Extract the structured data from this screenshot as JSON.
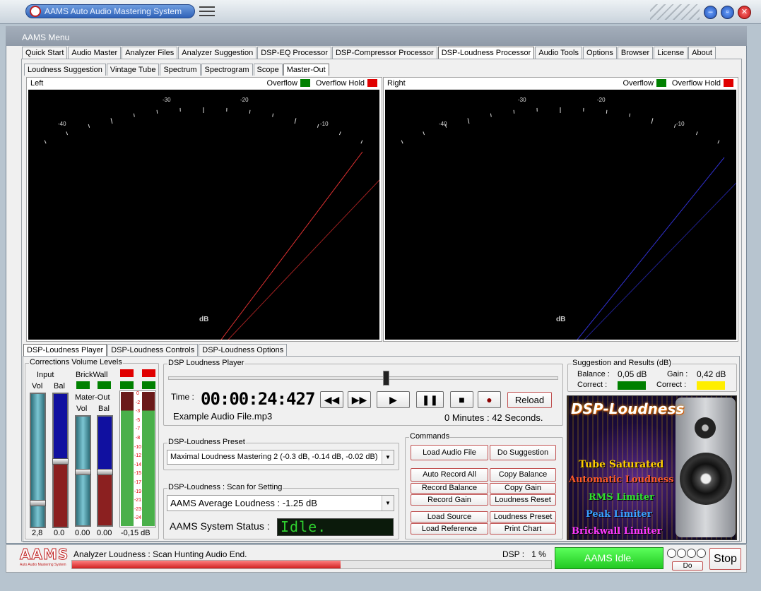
{
  "window": {
    "title": "AAMS Auto Audio Mastering System"
  },
  "menu_label": "AAMS Menu",
  "main_tabs": [
    "Quick Start",
    "Audio Master",
    "Analyzer Files",
    "Analyzer Suggestion",
    "DSP-EQ Processor",
    "DSP-Compressor Processor",
    "DSP-Loudness Processor",
    "Audio Tools",
    "Options",
    "Browser",
    "License",
    "About"
  ],
  "sub_tabs": [
    "Loudness Suggestion",
    "Vintage Tube",
    "Spectrum",
    "Spectrogram",
    "Scope",
    "Master-Out"
  ],
  "meters": {
    "left": {
      "label": "Left",
      "overflow": "Overflow",
      "overflow_hold": "Overflow Hold",
      "unit": "dB",
      "ticks": [
        "-40",
        "-30",
        "-20",
        "-10"
      ]
    },
    "right": {
      "label": "Right",
      "overflow": "Overflow",
      "overflow_hold": "Overflow Hold",
      "unit": "dB",
      "ticks": [
        "-40",
        "-30",
        "-20",
        "-10"
      ]
    }
  },
  "lower_tabs": [
    "DSP-Loudness Player",
    "DSP-Loudness Controls",
    "DSP-Loudness Options"
  ],
  "corrections": {
    "title": "Corrections Volume Levels",
    "input": "Input",
    "brickwall": "BrickWall",
    "mater_out": "Mater-Out",
    "vol": "Vol",
    "bal": "Bal",
    "vol_value": "2,8",
    "bal_value": "0.0",
    "out_vol_value": "0.00",
    "out_bal_value": "0.00",
    "meter_value": "-0,15 dB",
    "scale": [
      "0",
      "-2",
      "-3",
      "-5",
      "-7",
      "-8",
      "-10",
      "-12",
      "-14",
      "-15",
      "-17",
      "-19",
      "-21",
      "-23",
      "-24"
    ]
  },
  "player": {
    "title": "DSP Loudness Player",
    "time_label": "Time :",
    "time": "00:00:24:427",
    "file": "Example Audio File.mp3",
    "duration": "0 Minutes : 42 Seconds.",
    "reload": "Reload",
    "position_fraction": 0.56
  },
  "preset": {
    "title": "DSP-Loudness Preset",
    "value": "Maximal Loudness Mastering  2  (-0.3 dB, -0.14 dB, -0.02 dB)"
  },
  "scan": {
    "title": "DSP-Loudness : Scan for Setting",
    "value": "AAMS Average Loudness : -1.25 dB",
    "status_label": "AAMS System Status :",
    "status": "Idle."
  },
  "commands": {
    "title": "Commands",
    "load_audio": "Load Audio File",
    "do_suggestion": "Do Suggestion",
    "auto_record": "Auto Record All",
    "copy_balance": "Copy Balance",
    "record_balance": "Record Balance",
    "copy_gain": "Copy Gain",
    "record_gain": "Record Gain",
    "loudness_reset": "Loudness Reset",
    "load_source": "Load Source",
    "loudness_preset": "Loudness Preset",
    "load_reference": "Load Reference",
    "print_chart": "Print Chart"
  },
  "suggestion": {
    "title": "Suggestion and Results (dB)",
    "balance_label": "Balance :",
    "balance": "0,05 dB",
    "gain_label": "Gain :",
    "gain": "0,42 dB",
    "correct1": "Correct :",
    "correct2": "Correct :",
    "color_balance": "#008000",
    "color_gain": "#ffee00"
  },
  "banner": {
    "title": "DSP-Loudness",
    "lines": [
      "Tube Saturated",
      "Automatic Loudness",
      "RMS Limiter",
      "Peak Limiter",
      "Brickwall Limiter"
    ]
  },
  "statusbar": {
    "logo": "AAMS",
    "logo_sub": "Auto Audio Mastering System",
    "message": "Analyzer Loudness : Scan Hunting Audio End.",
    "dsp": "DSP :   1 %",
    "state": "AAMS Idle.",
    "do": "Do",
    "stop": "Stop",
    "progress_fraction": 0.56
  },
  "colors": {
    "accent": "#2f62b8",
    "alert": "#e00000",
    "ok": "#008000",
    "led": "#22dd22"
  }
}
